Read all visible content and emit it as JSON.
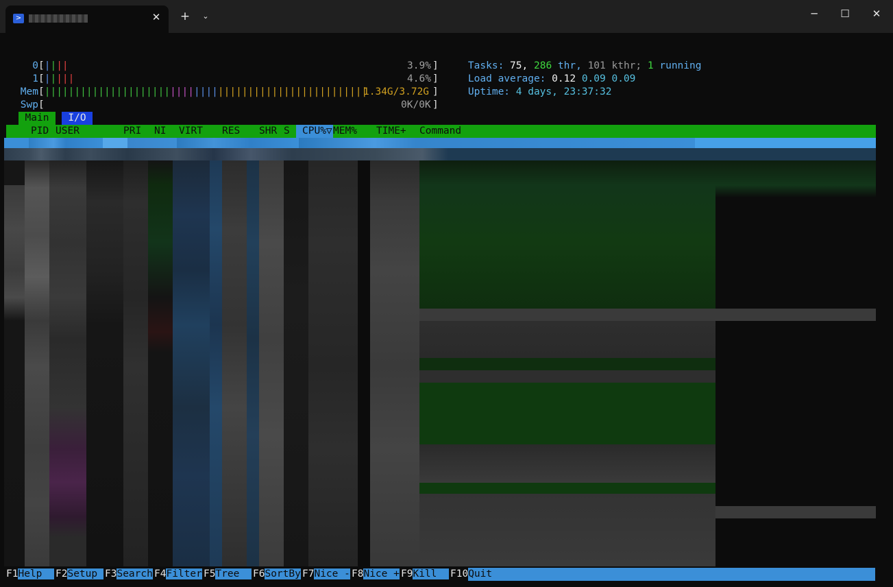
{
  "titlebar": {
    "tab_icon": "terminal-icon",
    "tab_close": "✕",
    "new_tab": "+",
    "dropdown": "⌄",
    "minimize": "─",
    "maximize": "☐",
    "close": "✕"
  },
  "meters": {
    "cpu0": {
      "label": "0",
      "percent": "3.9%"
    },
    "cpu1": {
      "label": "1",
      "percent": "4.6%"
    },
    "mem": {
      "label": "Mem",
      "value": "1.34G/3.72G"
    },
    "swp": {
      "label": "Swp",
      "value": "0K/0K"
    }
  },
  "summary": {
    "tasks_label": "Tasks:",
    "tasks": "75,",
    "threads": "286",
    "thr_label": "thr,",
    "kthreads": "101 kthr;",
    "running": "1",
    "running_label": "running",
    "load_label": "Load average:",
    "load1": "0.12",
    "load5": "0.09",
    "load15": "0.09",
    "uptime_label": "Uptime:",
    "uptime": "4 days, 23:37:32"
  },
  "tabs": {
    "main": "Main",
    "io": "I/O"
  },
  "columns": {
    "pid": "PID",
    "user": "USER",
    "pri": "PRI",
    "ni": "NI",
    "virt": "VIRT",
    "res": "RES",
    "shr": "SHR",
    "s": "S",
    "cpu": "CPU%▽",
    "mem": "MEM%",
    "time": "TIME+",
    "command": "Command"
  },
  "fkeys": [
    {
      "key": "F1",
      "label": "Help  "
    },
    {
      "key": "F2",
      "label": "Setup "
    },
    {
      "key": "F3",
      "label": "Search"
    },
    {
      "key": "F4",
      "label": "Filter"
    },
    {
      "key": "F5",
      "label": "Tree  "
    },
    {
      "key": "F6",
      "label": "SortBy"
    },
    {
      "key": "F7",
      "label": "Nice -"
    },
    {
      "key": "F8",
      "label": "Nice +"
    },
    {
      "key": "F9",
      "label": "Kill  "
    },
    {
      "key": "F10",
      "label": "Quit"
    }
  ],
  "colors": {
    "green": "#13a10e",
    "blue": "#3b8fd8",
    "accent": "#61afef"
  }
}
